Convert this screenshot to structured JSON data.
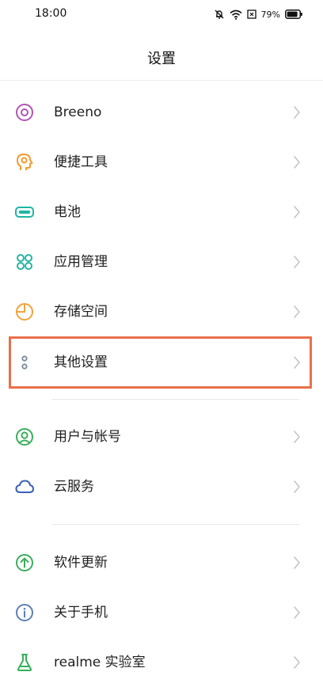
{
  "status": {
    "time": "18:00",
    "battery": "79%"
  },
  "header": {
    "title": "设置"
  },
  "items": [
    {
      "label": "Breeno"
    },
    {
      "label": "便捷工具"
    },
    {
      "label": "电池"
    },
    {
      "label": "应用管理"
    },
    {
      "label": "存储空间"
    },
    {
      "label": "其他设置"
    },
    {
      "label": "用户与帐号"
    },
    {
      "label": "云服务"
    },
    {
      "label": "软件更新"
    },
    {
      "label": "关于手机"
    },
    {
      "label": "realme 实验室"
    }
  ],
  "icons": {
    "breeno": "breeno-ring-icon",
    "tools": "head-gear-icon",
    "battery": "battery-icon",
    "apps": "app-grid-icon",
    "storage": "pie-chart-icon",
    "other": "two-dots-icon",
    "user": "user-icon",
    "cloud": "cloud-icon",
    "update": "upload-arrow-icon",
    "about": "info-icon",
    "lab": "flask-icon"
  },
  "colors": {
    "breeno": "#b354b3",
    "tools": "#f39a2e",
    "battery": "#1cb7a4",
    "apps": "#26b3a4",
    "storage": "#f2a33a",
    "other": "#7a8898",
    "user": "#3cae5c",
    "cloud": "#3b5fb8",
    "update": "#3cae5c",
    "about": "#5c7fb8",
    "lab": "#35b05a",
    "highlight": "#e9704a"
  }
}
